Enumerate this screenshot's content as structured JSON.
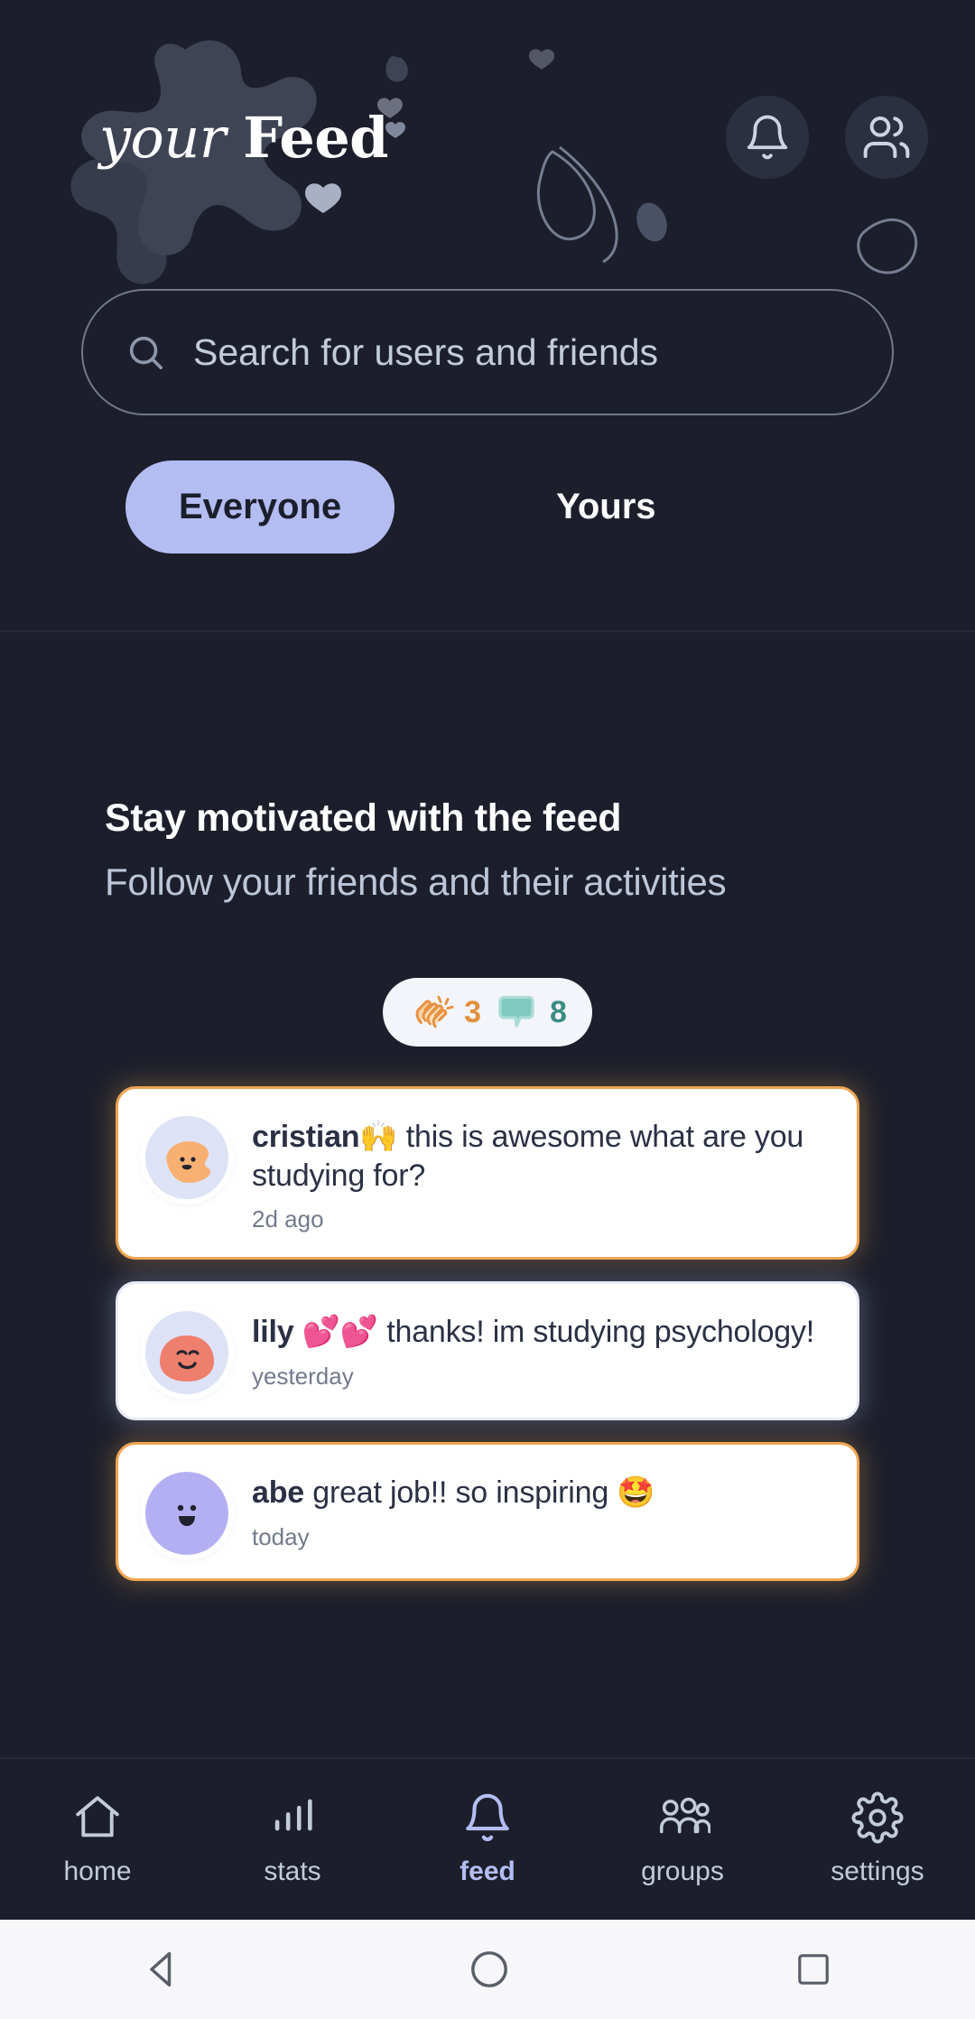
{
  "header": {
    "title_italic": "your",
    "title_bold": "Feed",
    "notifications_icon": "bell-icon",
    "friends_icon": "people-icon"
  },
  "search": {
    "icon": "search-icon",
    "placeholder": "Search for users and friends",
    "value": ""
  },
  "tabs": [
    {
      "label": "Everyone",
      "active": true
    },
    {
      "label": "Yours",
      "active": false
    }
  ],
  "promo": {
    "title": "Stay motivated with the feed",
    "subtitle": "Follow your friends and their activities"
  },
  "reactions": {
    "clap": {
      "icon": "clapping-hands-emoji",
      "count": "3"
    },
    "comment": {
      "icon": "speech-balloon-icon",
      "count": "8"
    }
  },
  "comments": [
    {
      "user": "cristian",
      "emoji": "🙌",
      "text": "this is awesome what are you studying for?",
      "time": "2d ago",
      "accent": "orange",
      "avatar": "blob-face-orange-avatar"
    },
    {
      "user": "lily",
      "emoji": "💕💕",
      "text": "thanks! im studying psychology!",
      "time": "yesterday",
      "accent": "light",
      "avatar": "blob-face-salmon-avatar"
    },
    {
      "user": "abe",
      "emoji": "",
      "text": "great job!! so inspiring 🤩",
      "time": "today",
      "accent": "orange",
      "avatar": "smiley-face-purple-avatar"
    }
  ],
  "bottom_nav": [
    {
      "label": "home",
      "icon": "home-icon",
      "active": false
    },
    {
      "label": "stats",
      "icon": "bar-chart-icon",
      "active": false
    },
    {
      "label": "feed",
      "icon": "bell-icon",
      "active": true
    },
    {
      "label": "groups",
      "icon": "people-icon",
      "active": false
    },
    {
      "label": "settings",
      "icon": "gear-icon",
      "active": false
    }
  ],
  "android_nav": [
    {
      "label": "back",
      "icon": "triangle-back-icon"
    },
    {
      "label": "home",
      "icon": "circle-home-icon"
    },
    {
      "label": "recent",
      "icon": "square-recent-icon"
    }
  ],
  "colors": {
    "background": "#1c1f2b",
    "accent": "#b4bdf2",
    "card": "#ffffff",
    "orange": "#f0a552",
    "teal": "#3d8c85"
  }
}
